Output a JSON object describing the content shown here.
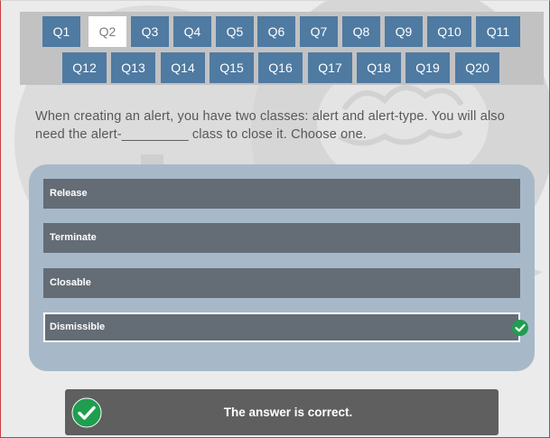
{
  "nav": {
    "row1": [
      "Q1",
      "Q2",
      "Q3",
      "Q4",
      "Q5",
      "Q6",
      "Q7",
      "Q8",
      "Q9",
      "Q10",
      "Q11"
    ],
    "row2": [
      "Q12",
      "Q13",
      "Q14",
      "Q15",
      "Q16",
      "Q17",
      "Q18",
      "Q19",
      "Q20"
    ],
    "active": "Q2"
  },
  "question": {
    "text": "When creating an alert, you have two classes: alert and alert-type. You will also need the alert-_________ class to close it. Choose one."
  },
  "options": [
    {
      "label": "Release",
      "selected": false
    },
    {
      "label": "Terminate",
      "selected": false
    },
    {
      "label": "Closable",
      "selected": false
    },
    {
      "label": "Dismissible",
      "selected": true
    }
  ],
  "result": {
    "text": "The answer is correct."
  },
  "colors": {
    "nav_button": "#4f7aa1",
    "option_bg": "#646c75",
    "panel_bg": "#a7b9c9",
    "correct_green": "#1f9e50",
    "result_bg": "#5f5f5f"
  },
  "icons": {
    "background": [
      "question-mark-bubble-icon",
      "brain-bubble-icon"
    ],
    "selected_marker": "check-circle-icon",
    "result_marker": "check-circle-icon"
  }
}
